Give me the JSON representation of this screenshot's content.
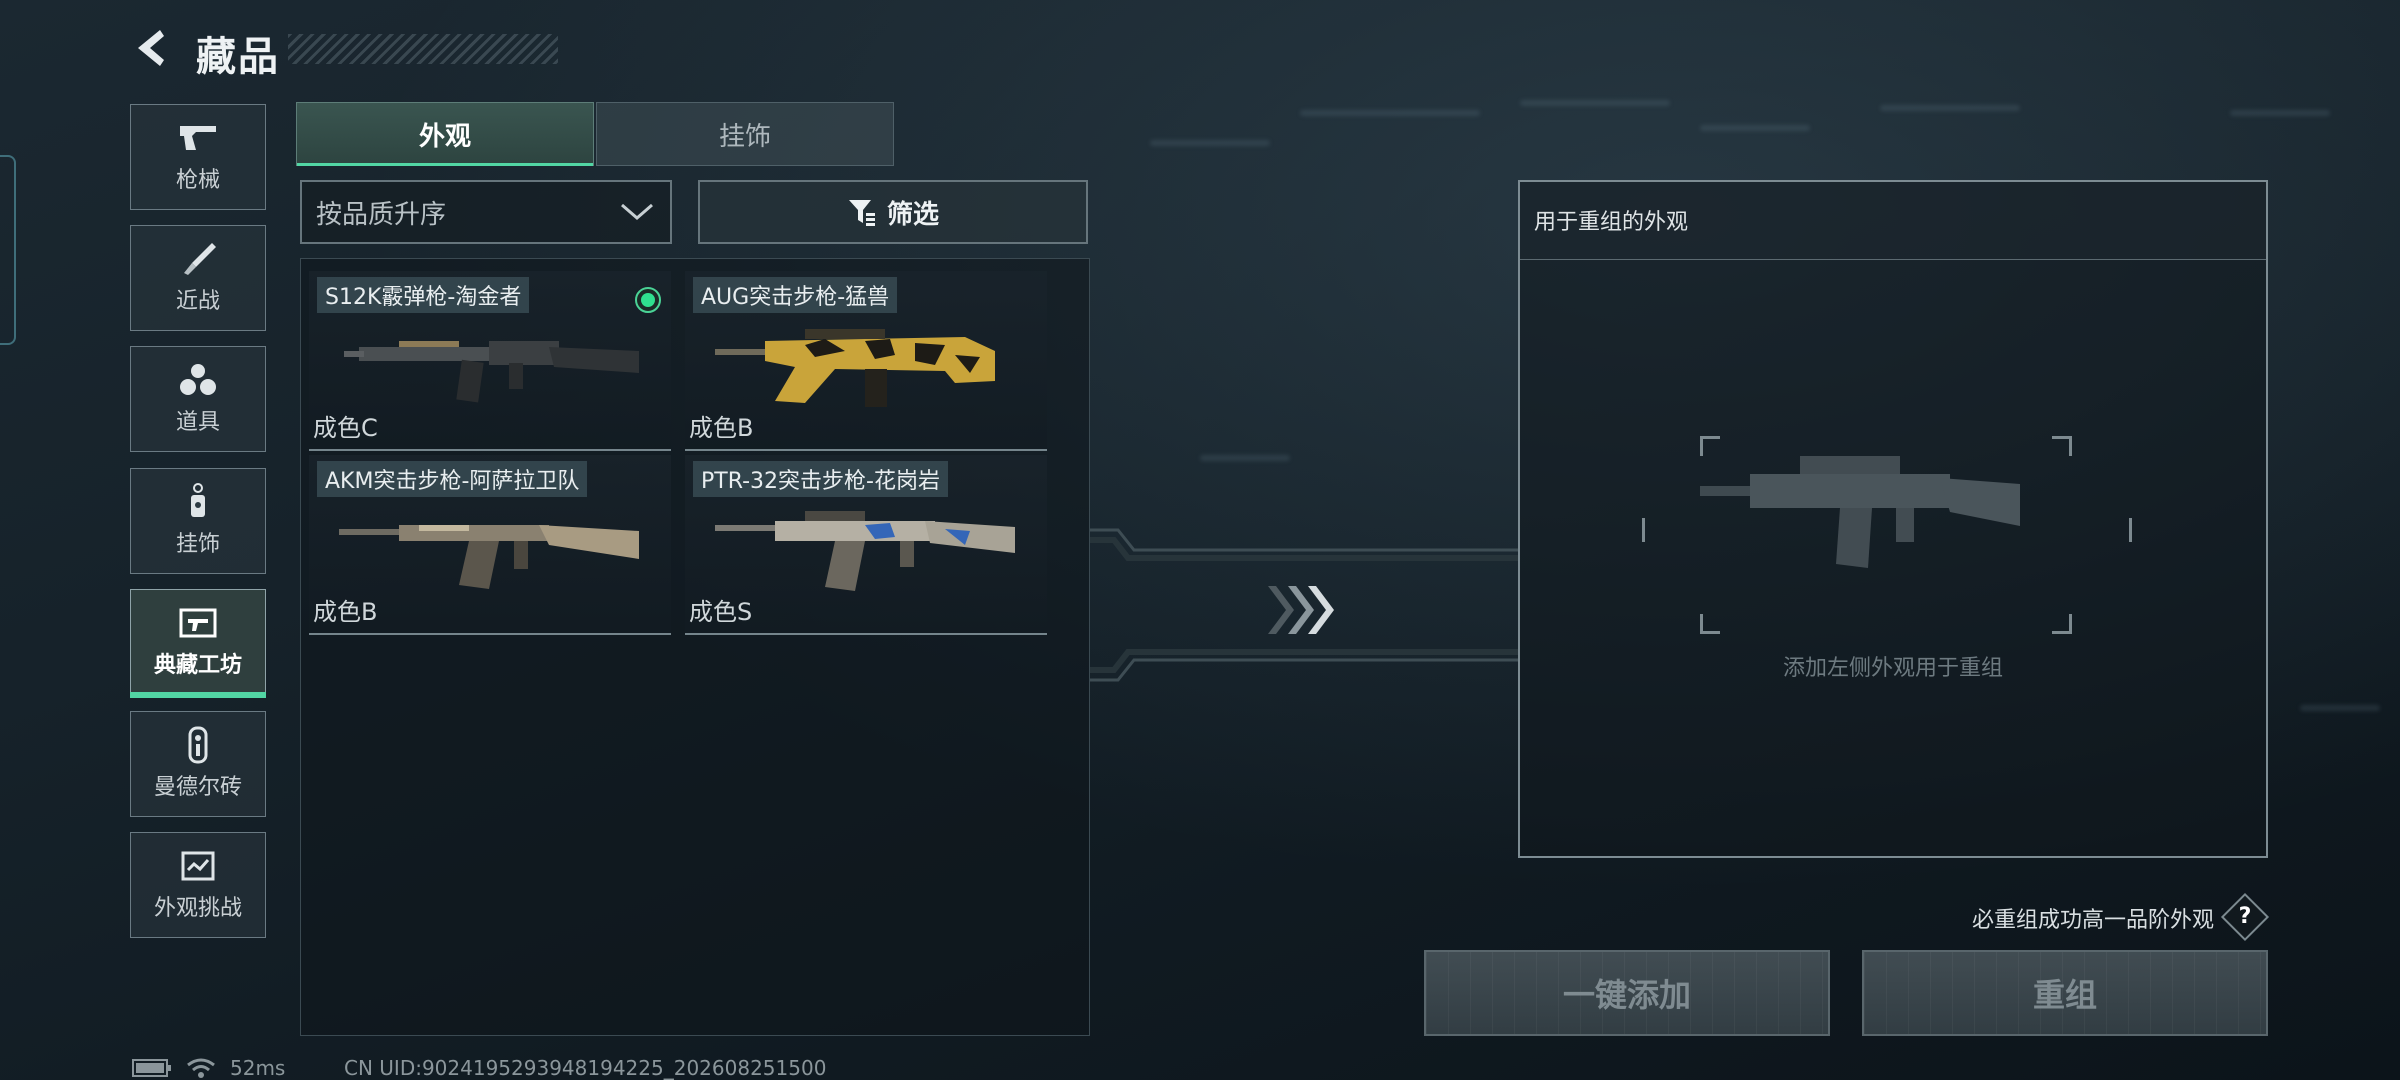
{
  "header": {
    "title": "藏品"
  },
  "sidebar": {
    "items": [
      {
        "label": "枪械",
        "icon": "pistol-icon",
        "active": false
      },
      {
        "label": "近战",
        "icon": "knife-icon",
        "active": false
      },
      {
        "label": "道具",
        "icon": "grenades-icon",
        "active": false
      },
      {
        "label": "挂饰",
        "icon": "charm-icon",
        "active": false
      },
      {
        "label": "典藏工坊",
        "icon": "workshop-icon",
        "active": true
      },
      {
        "label": "曼德尔砖",
        "icon": "brick-icon",
        "active": false
      },
      {
        "label": "外观挑战",
        "icon": "challenge-icon",
        "active": false
      }
    ]
  },
  "tabs": [
    {
      "label": "外观",
      "active": true
    },
    {
      "label": "挂饰",
      "active": false
    }
  ],
  "sort": {
    "value": "按品质升序"
  },
  "filter": {
    "label": "筛选"
  },
  "items": [
    {
      "name": "S12K霰弹枪-淘金者",
      "grade": "成色C",
      "equipped": true
    },
    {
      "name": "AUG突击步枪-猛兽",
      "grade": "成色B",
      "equipped": false
    },
    {
      "name": "AKM突击步枪-阿萨拉卫队",
      "grade": "成色B",
      "equipped": false
    },
    {
      "name": "PTR-32突击步枪-花岗岩",
      "grade": "成色S",
      "equipped": false
    }
  ],
  "reassemble": {
    "panel_title": "用于重组的外观",
    "placeholder": "添加左侧外观用于重组",
    "hint": "必重组成功高一品阶外观",
    "help_label": "?",
    "add_all_button": "一键添加",
    "reassemble_button": "重组"
  },
  "status": {
    "ping": "52ms",
    "uid": "CN UID:9024195293948194225_202608251500"
  },
  "colors": {
    "accent_green": "#52d6a4",
    "equipped_dot": "#2fe08f"
  }
}
